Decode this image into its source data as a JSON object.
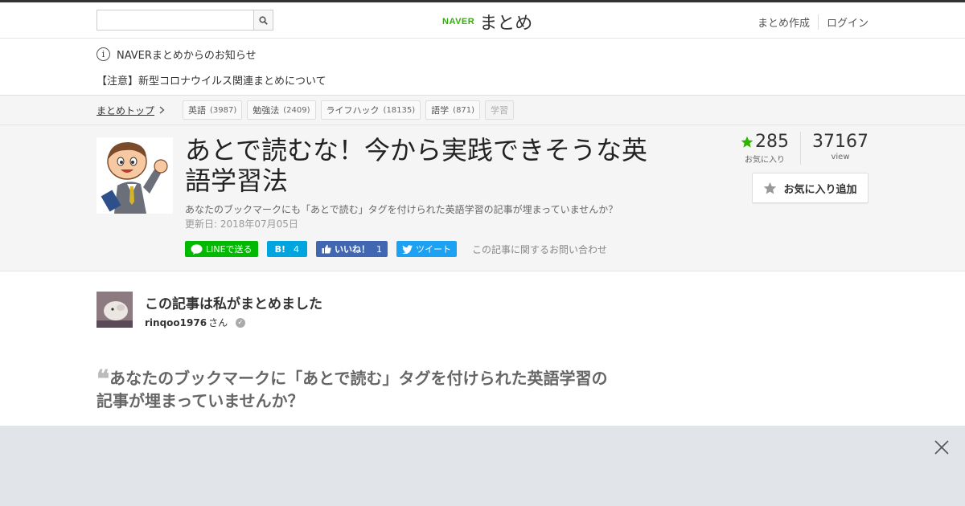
{
  "header": {
    "search_placeholder": "",
    "logo_brand": "NAVER",
    "logo_name": "まとめ",
    "links": [
      "まとめ作成",
      "ログイン"
    ]
  },
  "notice": {
    "title": "NAVERまとめからのお知らせ",
    "link": "【注意】新型コロナウイルス関連まとめについて"
  },
  "breadcrumb": {
    "top": "まとめトップ",
    "tags": [
      {
        "label": "英語",
        "count": "(3987)"
      },
      {
        "label": "勉強法",
        "count": "(2409)"
      },
      {
        "label": "ライフハック",
        "count": "(18135)"
      },
      {
        "label": "語学",
        "count": "(871)"
      },
      {
        "label": "学習",
        "count": ""
      }
    ]
  },
  "article": {
    "title": "あとで読むな！今から実践できそうな英語学習法",
    "description": "あなたのブックマークにも「あとで読む」タグを付けられた英語学習の記事が埋まっていませんか？",
    "updated": "更新日: 2018年07月05日",
    "share": {
      "line": "LINEで送る",
      "hatena_count": "4",
      "fb_label": "いいね！",
      "fb_count": "1",
      "tweet": "ツイート"
    },
    "contact": "この記事に関するお問い合わせ",
    "favorites": "285",
    "favorites_label": "お気に入り",
    "views": "37167",
    "views_label": "view",
    "fav_button": "お気に入り追加"
  },
  "author": {
    "heading": "この記事は私がまとめました",
    "name": "rinqoo1976",
    "suffix": "さん"
  },
  "quote": {
    "text": "あなたのブックマークに「あとで読む」タグを付けられた英語学習の記事が埋まっていませんか？"
  },
  "colors": {
    "naver_green": "#2db400",
    "line_green": "#00b900",
    "hatena_blue": "#00a4de",
    "facebook_blue": "#4267b2",
    "twitter_blue": "#1da1f2"
  }
}
